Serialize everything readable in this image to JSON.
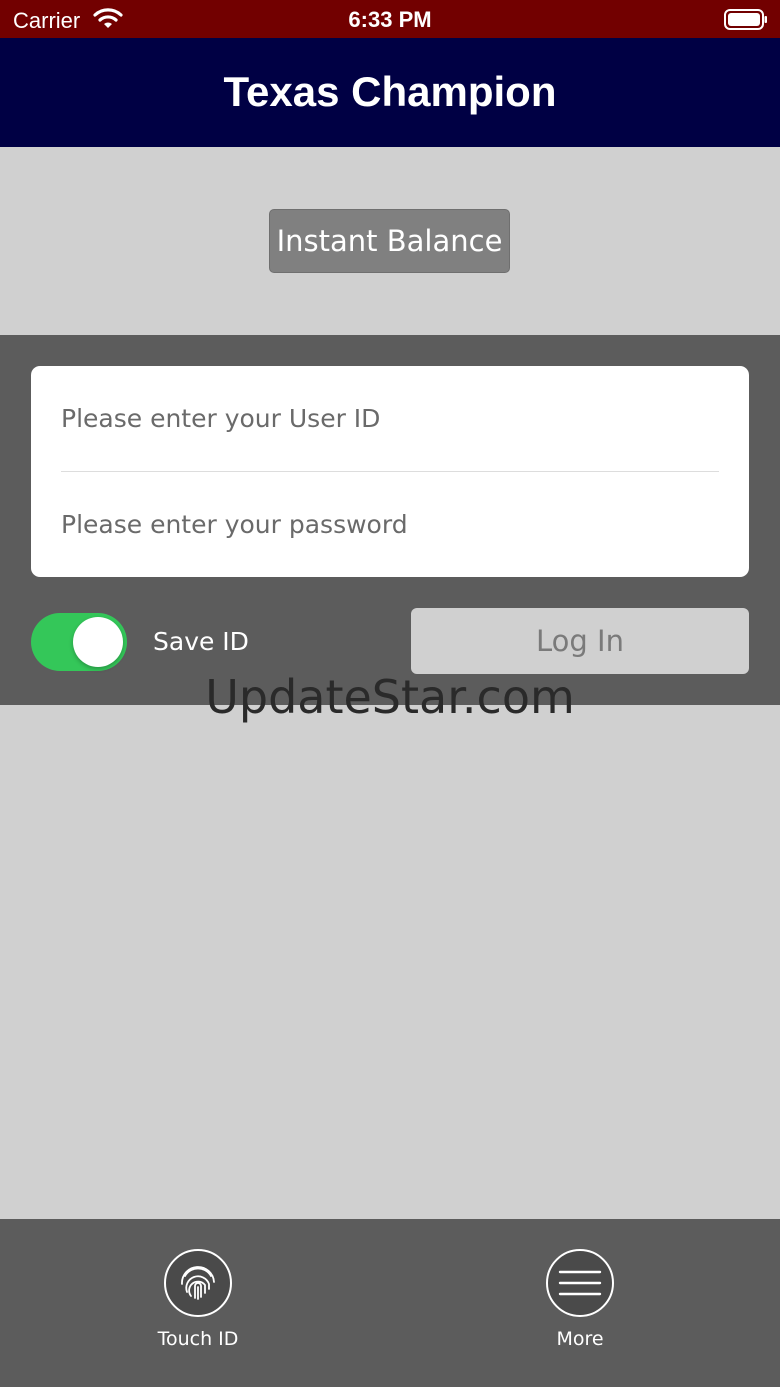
{
  "status_bar": {
    "carrier": "Carrier",
    "time": "6:33 PM",
    "wifi_icon": "wifi-icon",
    "battery_icon": "battery-icon"
  },
  "header": {
    "title": "Texas Champion"
  },
  "balance": {
    "button_label": "Instant Balance"
  },
  "login": {
    "user_id_placeholder": "Please enter your User ID",
    "user_id_value": "",
    "password_placeholder": "Please enter your password",
    "password_value": "",
    "save_id_label": "Save ID",
    "save_id_on": true,
    "login_label": "Log In"
  },
  "watermark": "UpdateStar.com",
  "tab_bar": {
    "items": [
      {
        "label": "Touch ID",
        "icon": "fingerprint-icon"
      },
      {
        "label": "More",
        "icon": "menu-icon"
      }
    ]
  },
  "colors": {
    "status_bar": "#720000",
    "header": "#000044",
    "panel": "#5c5c5c",
    "toggle_on": "#34c759"
  }
}
